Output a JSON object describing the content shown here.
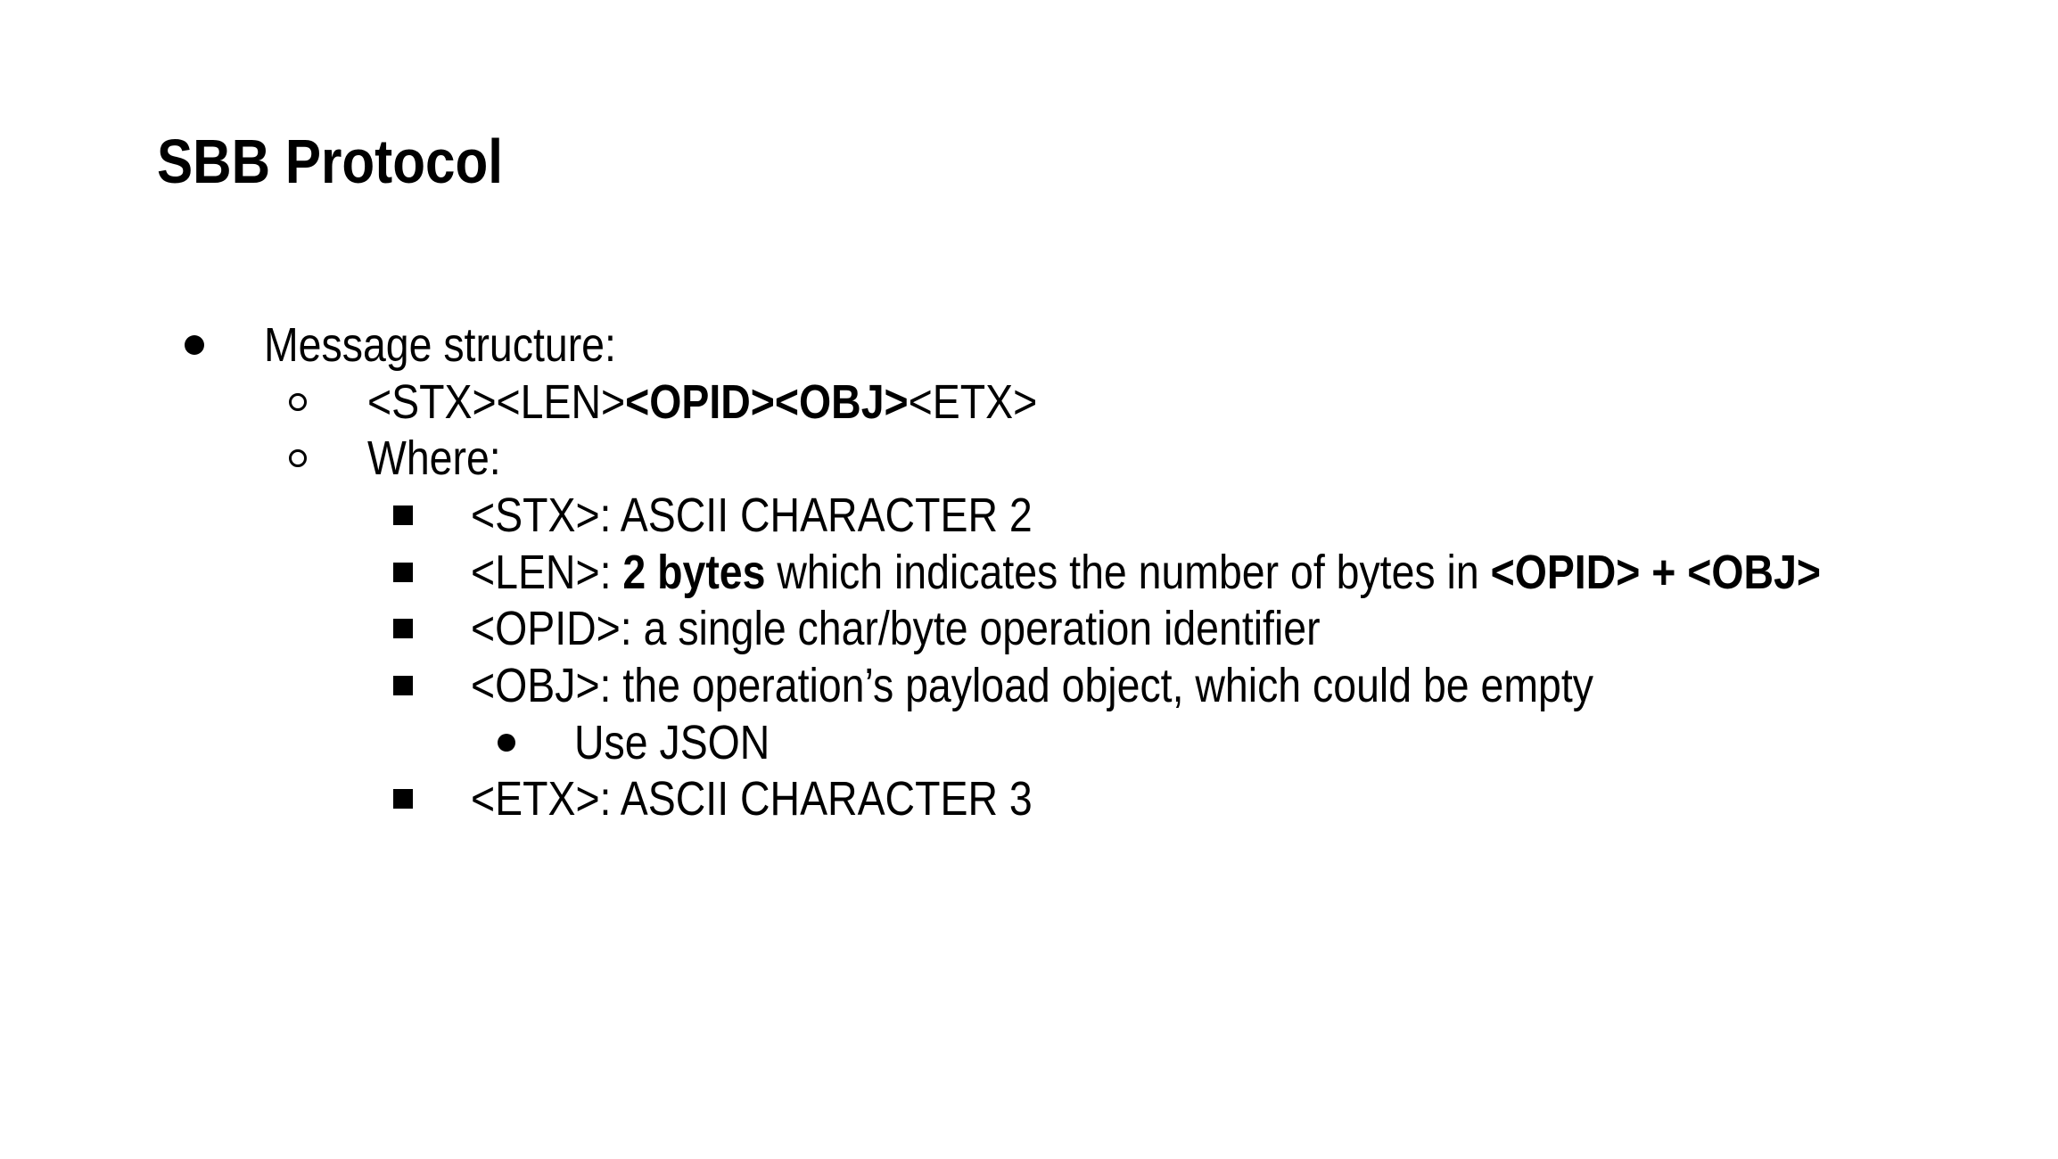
{
  "slide": {
    "title": "SBB Protocol",
    "items": {
      "message_structure": "Message structure:",
      "format": {
        "stx": "<STX>",
        "len": "<LEN>",
        "opid_obj": "<OPID><OBJ>",
        "etx": "<ETX>"
      },
      "where": "Where:",
      "stx_def": "<STX>: ASCII CHARACTER 2",
      "len_def": {
        "prefix": "<LEN>: ",
        "bold1": "2 bytes",
        "middle": " which indicates the number of bytes in ",
        "bold2": "<OPID> + <OBJ>"
      },
      "opid_def": "<OPID>: a single char/byte operation identifier",
      "obj_def": "<OBJ>: the operation’s payload object, which could be empty",
      "use_json": "Use JSON",
      "etx_def": "<ETX>: ASCII CHARACTER 3"
    }
  }
}
